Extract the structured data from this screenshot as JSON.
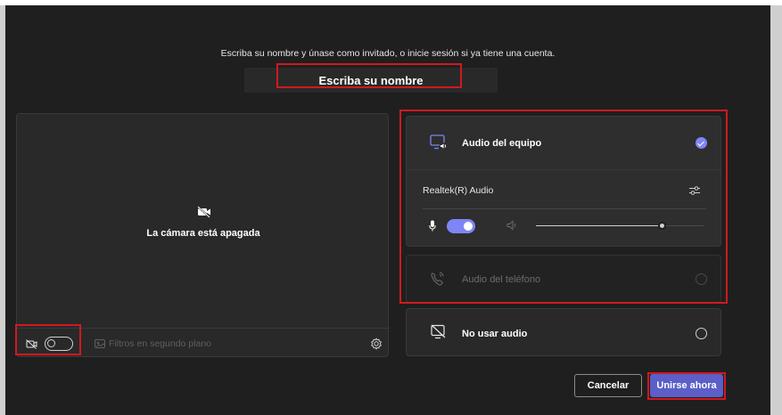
{
  "prejoin": {
    "prompt": "Escriba su nombre y únase como invitado, o inicie sesión si ya tiene una cuenta.",
    "name_placeholder": "Escriba su nombre",
    "name_value": ""
  },
  "video": {
    "camera_off_text": "La cámara está apagada",
    "camera_toggle_on": false,
    "background_filters_label": "Filtros en segundo plano"
  },
  "audio": {
    "options": [
      {
        "label": "Audio del equipo",
        "selected": true,
        "icon": "computer-audio-icon"
      },
      {
        "label": "Audio del teléfono",
        "selected": false,
        "disabled": true,
        "icon": "phone-audio-icon"
      },
      {
        "label": "No usar audio",
        "selected": false,
        "icon": "no-audio-icon"
      }
    ],
    "device_name": "Realtek(R) Audio",
    "mic_toggle_on": true,
    "speaker_volume": 0.75
  },
  "actions": {
    "cancel_label": "Cancelar",
    "join_label": "Unirse ahora"
  },
  "colors": {
    "accent": "#7f85f5",
    "primary_button": "#5b5fc7",
    "highlight": "#d0191f",
    "background": "#1f1f1f"
  }
}
